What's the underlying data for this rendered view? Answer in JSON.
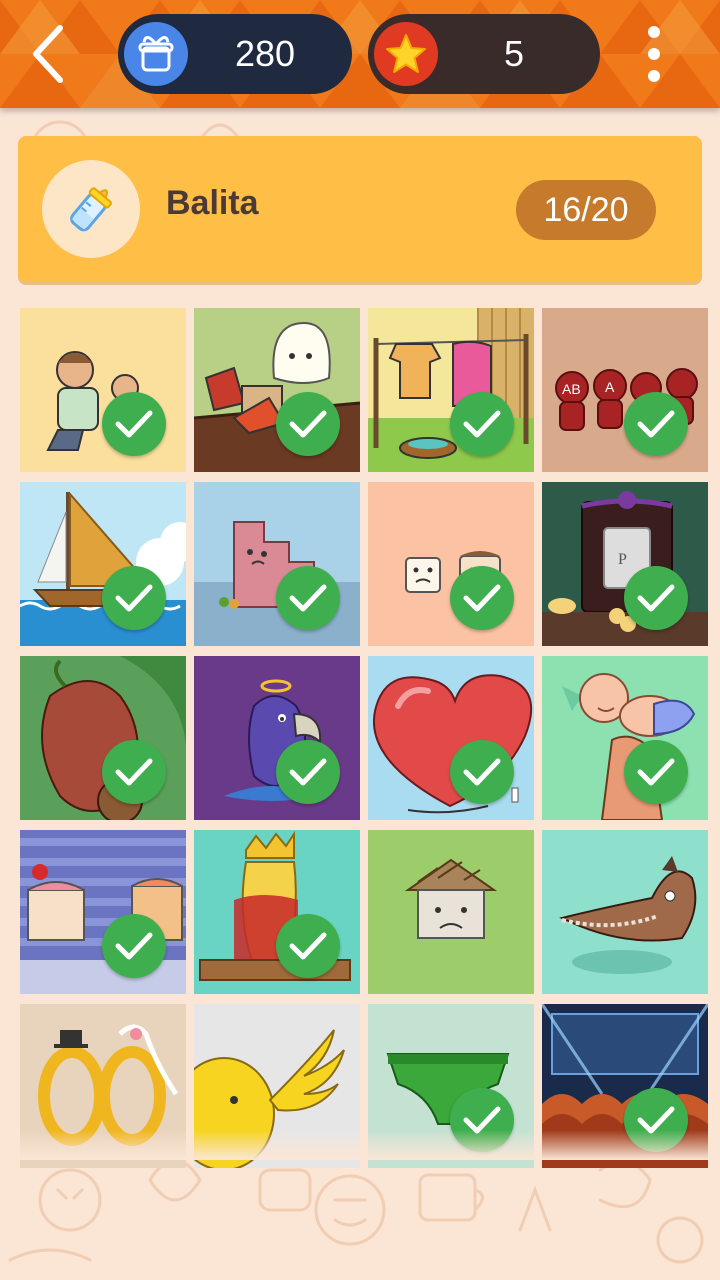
{
  "header": {
    "gifts": "280",
    "stars": "5",
    "icons": [
      "back-arrow-icon",
      "gift-icon",
      "star-icon",
      "more-vertical-icon"
    ],
    "colors": {
      "bar": "#f07a1a",
      "gift_pill": "#1f2940",
      "star_pill": "#3a2b2b"
    }
  },
  "category": {
    "title": "Balita",
    "progress": "16/20",
    "icon": "baby-bottle-icon",
    "color": "#ffbe45"
  },
  "puzzles": [
    {
      "name": "father-and-child",
      "solved": true
    },
    {
      "name": "rice-ghost-table",
      "solved": true
    },
    {
      "name": "clothesline",
      "solved": true
    },
    {
      "name": "blood-types",
      "solved": true
    },
    {
      "name": "sailboat",
      "solved": true
    },
    {
      "name": "sad-stairs",
      "solved": true
    },
    {
      "name": "tooth-and-cake",
      "solved": true
    },
    {
      "name": "grave-flowers",
      "solved": true
    },
    {
      "name": "cashew-monkey",
      "solved": true
    },
    {
      "name": "parrot-genie",
      "solved": true
    },
    {
      "name": "big-heart",
      "solved": true
    },
    {
      "name": "baby-lifted",
      "solved": true
    },
    {
      "name": "cake-friends",
      "solved": true
    },
    {
      "name": "banana-king",
      "solved": true
    },
    {
      "name": "sad-house",
      "solved": false
    },
    {
      "name": "horse-crocodile",
      "solved": false
    },
    {
      "name": "ring-couple",
      "solved": false
    },
    {
      "name": "winged-chick",
      "solved": false
    },
    {
      "name": "green-underwear",
      "solved": true
    },
    {
      "name": "concert-crowd",
      "solved": true
    }
  ]
}
